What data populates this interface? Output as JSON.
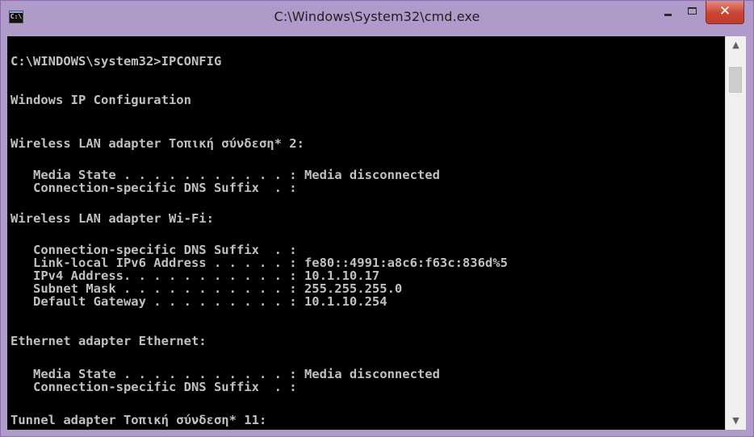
{
  "window": {
    "title": "C:\\Windows\\System32\\cmd.exe",
    "icon_label": "C:\\",
    "controls": {
      "minimize_icon": "minimize-icon",
      "maximize_icon": "maximize-icon",
      "close_symbol": "✕"
    }
  },
  "console": {
    "lines": [
      "C:\\WINDOWS\\system32>IPCONFIG",
      "Windows IP Configuration",
      "Wireless LAN adapter Τοπική σύνδεση* 2:",
      "   Media State . . . . . . . . . . . : Media disconnected",
      "   Connection-specific DNS Suffix  . :",
      "Wireless LAN adapter Wi-Fi:",
      "   Connection-specific DNS Suffix  . :",
      "   Link-local IPv6 Address . . . . . : fe80::4991:a8c6:f63c:836d%5",
      "   IPv4 Address. . . . . . . . . . . : 10.1.10.17",
      "   Subnet Mask . . . . . . . . . . . : 255.255.255.0",
      "   Default Gateway . . . . . . . . . : 10.1.10.254",
      "Ethernet adapter Ethernet:",
      "   Media State . . . . . . . . . . . : Media disconnected",
      "   Connection-specific DNS Suffix  . :",
      "Tunnel adapter Τοπική σύνδεση* 11:"
    ]
  },
  "scrollbar": {
    "up_arrow": "▲",
    "down_arrow": "▼"
  },
  "colors": {
    "frame": "#b09ac9",
    "console_bg": "#000000",
    "console_text": "#c0c0c0",
    "close_button": "#c74534"
  }
}
